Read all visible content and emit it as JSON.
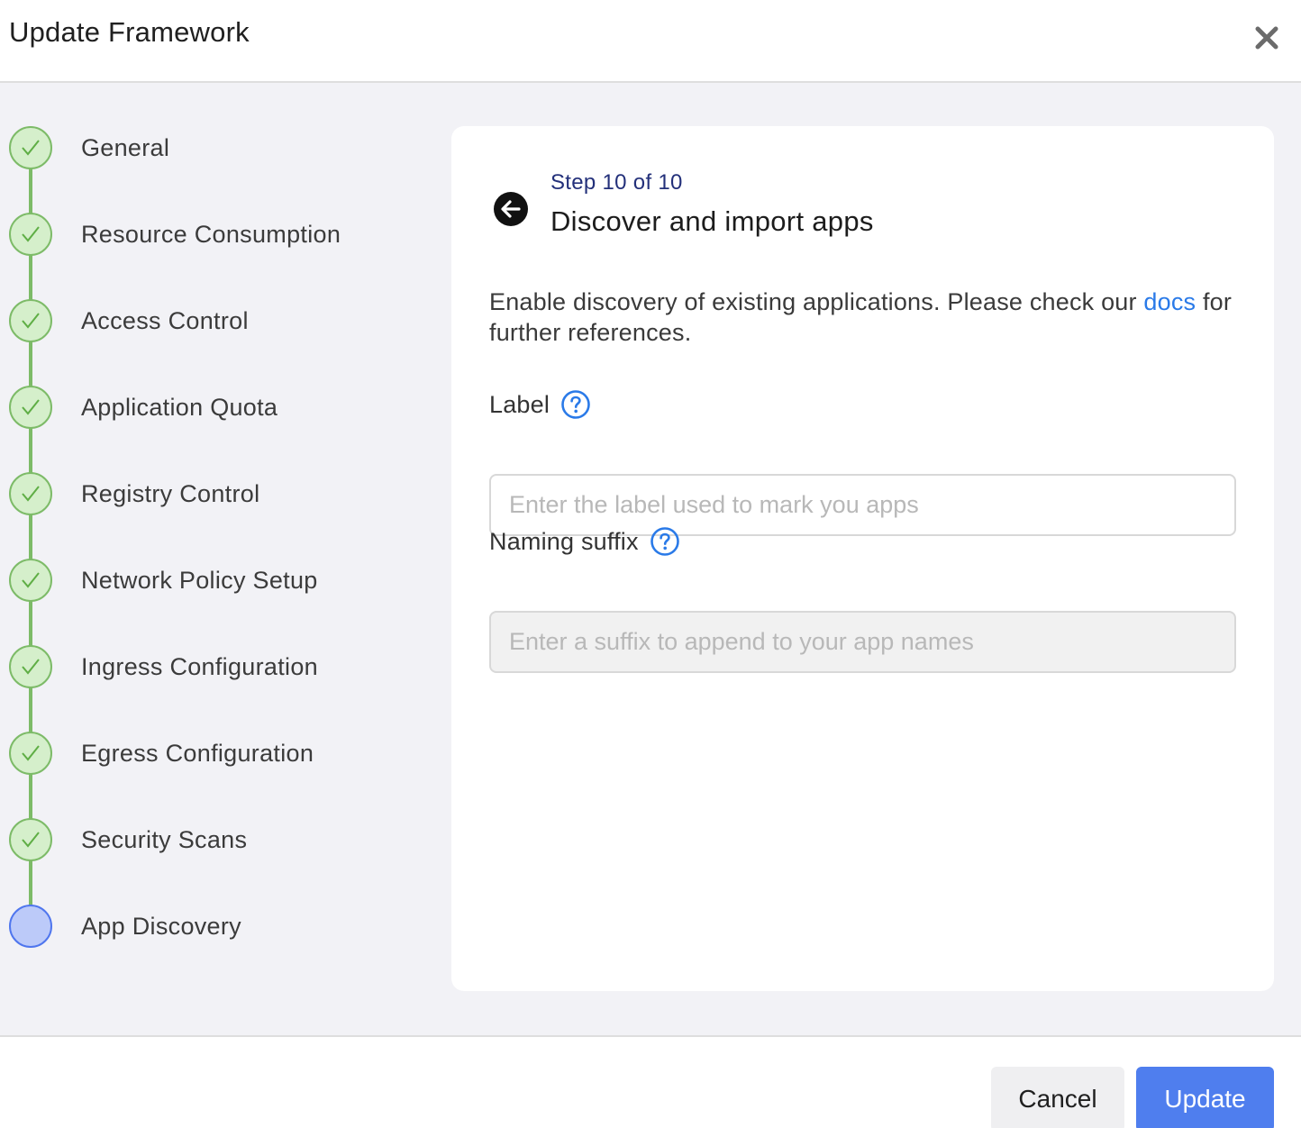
{
  "dialog": {
    "title": "Update Framework",
    "close_icon": "close-icon"
  },
  "steps": [
    {
      "label": "General",
      "status": "complete"
    },
    {
      "label": "Resource Consumption",
      "status": "complete"
    },
    {
      "label": "Access Control",
      "status": "complete"
    },
    {
      "label": "Application Quota",
      "status": "complete"
    },
    {
      "label": "Registry Control",
      "status": "complete"
    },
    {
      "label": "Network Policy Setup",
      "status": "complete"
    },
    {
      "label": "Ingress Configuration",
      "status": "complete"
    },
    {
      "label": "Egress Configuration",
      "status": "complete"
    },
    {
      "label": "Security Scans",
      "status": "complete"
    },
    {
      "label": "App Discovery",
      "status": "current"
    }
  ],
  "card": {
    "step_count": "Step 10 of 10",
    "title": "Discover and import apps",
    "description": "Enable discovery of existing applications. Please check our",
    "docs_link": "docs",
    "description_end": "for further references.",
    "label_field": {
      "label": "Label",
      "value": "",
      "placeholder": "Enter the label used to mark you apps"
    },
    "suffix_field": {
      "label": "Naming suffix",
      "value": "",
      "placeholder": "Enter a suffix to append to your app names"
    }
  },
  "footer": {
    "cancel_label": "Cancel",
    "update_label": "Update"
  },
  "colors": {
    "complete": "#7dbb68",
    "current": "#4f76ee",
    "primary_button": "#4f7eee",
    "link": "#2a7ae8"
  }
}
